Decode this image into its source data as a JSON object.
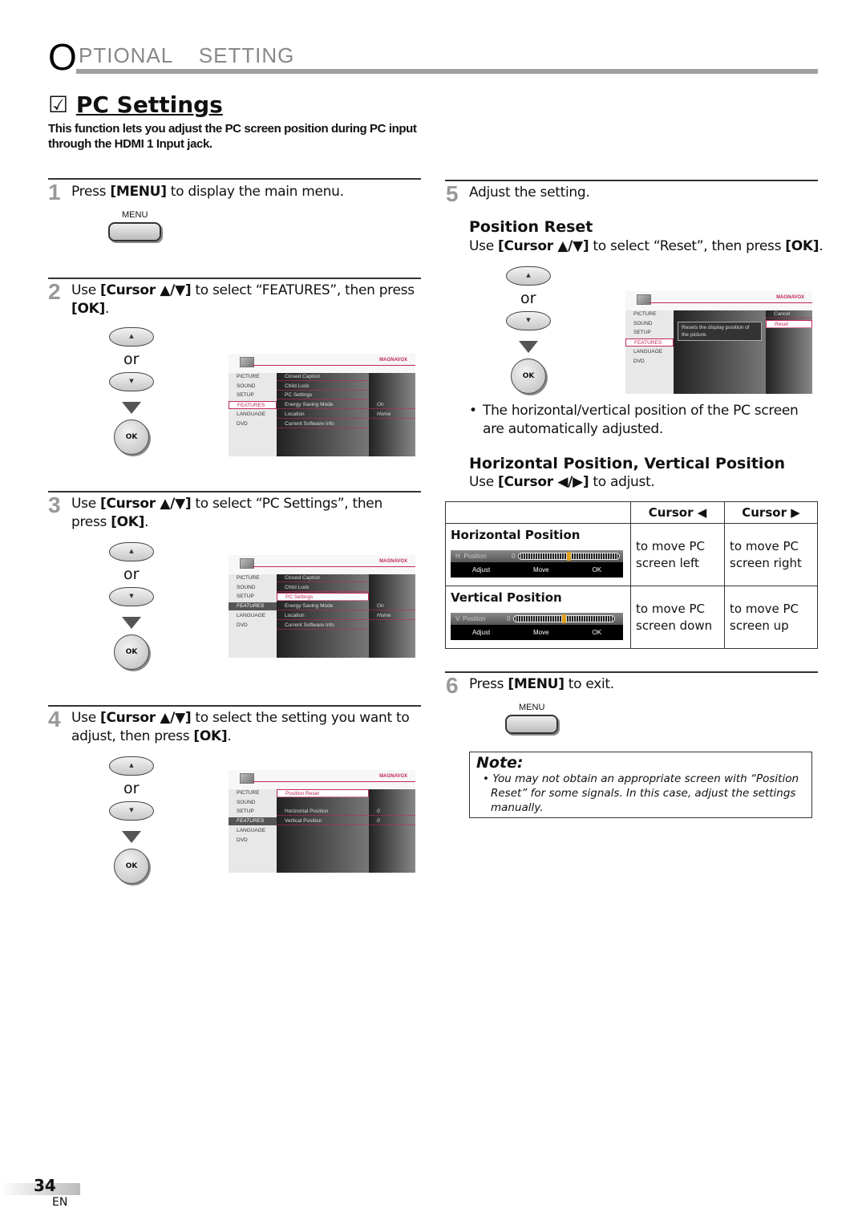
{
  "header": {
    "initial": "O",
    "rest": "PTIONAL  SETTING"
  },
  "title": {
    "checkbox": "☑",
    "text": "PC Settings"
  },
  "description": "This function lets you adjust the PC screen position during PC input through the HDMI 1 Input jack.",
  "remote": {
    "or": "or",
    "ok": "OK",
    "menu": "MENU",
    "up": "▲",
    "down": "▼"
  },
  "steps": [
    {
      "num": "1",
      "html": "Press <b>[MENU]</b> to display the main menu."
    },
    {
      "num": "2",
      "html": "Use <b>[Cursor ▲/▼]</b> to select “FEATURES”, then press <b>[OK]</b>."
    },
    {
      "num": "3",
      "html": "Use <b>[Cursor ▲/▼]</b> to select “PC Settings”, then press <b>[OK]</b>."
    },
    {
      "num": "4",
      "html": "Use <b>[Cursor ▲/▼]</b> to select the setting you want to adjust, then press <b>[OK]</b>."
    },
    {
      "num": "5",
      "html": "Adjust the setting."
    },
    {
      "num": "6",
      "html": "Press <b>[MENU]</b> to exit."
    }
  ],
  "position_reset": {
    "heading": "Position Reset",
    "instruction": "Use <b>[Cursor ▲/▼]</b> to select “Reset”, then press <b>[OK]</b>.",
    "bullet": "The horizontal/vertical position of the PC screen are automatically adjusted."
  },
  "hv_position": {
    "heading": "Horizontal Position, Vertical Position",
    "instruction": "Use <b>[Cursor ◀/▶]</b> to adjust."
  },
  "table": {
    "headers": [
      "",
      "Cursor ◀",
      "Cursor ▶"
    ],
    "rows": [
      {
        "name": "Horizontal Position",
        "osd_label": "H. Position",
        "osd_value": "0",
        "left": "to move PC screen left",
        "right": "to move PC screen right"
      },
      {
        "name": "Vertical Position",
        "osd_label": "V. Position",
        "osd_value": "0",
        "left": "to move PC screen down",
        "right": "to move PC screen up"
      }
    ],
    "osd_hints": [
      "Adjust",
      "Move",
      "OK"
    ]
  },
  "note": {
    "heading": "Note:",
    "text": "You may not obtain an appropriate screen with “Position Reset” for some signals. In this case, adjust the settings manually."
  },
  "menus": [
    {
      "brand": "MAGNAVOX",
      "left": [
        "PICTURE",
        "SOUND",
        "SETUP",
        "FEATURES",
        "LANGUAGE",
        "DVD"
      ],
      "left_sel": 3,
      "left_style": "sel",
      "mid": [
        "Closed Caption",
        "Child Lock",
        "PC Settings",
        "Energy Saving Mode",
        "Location",
        "Current Software Info"
      ],
      "mid_sel": -1,
      "right": [
        "",
        "",
        "",
        "On",
        "Home",
        ""
      ]
    },
    {
      "brand": "MAGNAVOX",
      "left": [
        "PICTURE",
        "SOUND",
        "SETUP",
        "FEATURES",
        "LANGUAGE",
        "DVD"
      ],
      "left_sel": 3,
      "left_style": "fill",
      "mid": [
        "Closed Caption",
        "Child Lock",
        "PC Settings",
        "Energy Saving Mode",
        "Location",
        "Current Software Info"
      ],
      "mid_sel": 2,
      "right": [
        "",
        "",
        "",
        "On",
        "Home",
        ""
      ]
    },
    {
      "brand": "MAGNAVOX",
      "left": [
        "PICTURE",
        "SOUND",
        "SETUP",
        "FEATURES",
        "LANGUAGE",
        "DVD"
      ],
      "left_sel": 3,
      "left_style": "fill",
      "mid": [
        "Position Reset",
        "",
        "Horizontal Position",
        "Vertical Position"
      ],
      "mid_sel": 0,
      "right": [
        "",
        "",
        "0",
        "0"
      ]
    },
    {
      "brand": "MAGNAVOX",
      "left": [
        "PICTURE",
        "SOUND",
        "SETUP",
        "FEATURES",
        "LANGUAGE",
        "DVD"
      ],
      "left_sel": 3,
      "left_style": "sel",
      "desc": "Resets the display position of the picture.",
      "mid": [],
      "mid_sel": -1,
      "right": [
        "Cancel",
        "Reset"
      ],
      "right_sel": 1
    }
  ],
  "page": {
    "number": "34",
    "lang": "EN"
  },
  "colors": {
    "accent": "#c0285a",
    "rule": "#a0a0a0"
  }
}
